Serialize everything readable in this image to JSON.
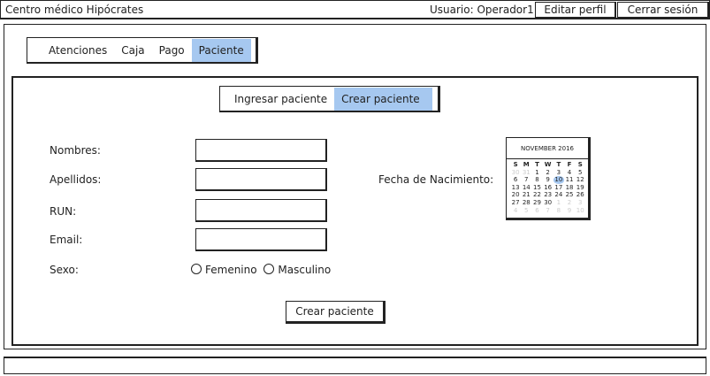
{
  "app": {
    "title": "Centro médico Hipócrates"
  },
  "header": {
    "user": "Usuario: Operador1",
    "edit_profile": "Editar perfil",
    "logout": "Cerrar sesión"
  },
  "nav": {
    "tabs": [
      "Atenciones",
      "Caja",
      "Pago",
      "Paciente"
    ],
    "active_index": 3
  },
  "subtabs": {
    "items": [
      "Ingresar paciente",
      "Crear paciente"
    ],
    "active_index": 1
  },
  "form": {
    "nombres_label": "Nombres:",
    "apellidos_label": "Apellidos:",
    "run_label": "RUN:",
    "email_label": "Email:",
    "sexo_label": "Sexo:",
    "sexo_options": [
      "Femenino",
      "Masculino"
    ],
    "fecha_label": "Fecha de Nacimiento:",
    "submit": "Crear paciente"
  },
  "calendar": {
    "title": "NOVEMBER 2016",
    "weekdays": [
      "S",
      "M",
      "T",
      "W",
      "T",
      "F",
      "S"
    ],
    "weeks": [
      [
        {
          "d": "30",
          "m": true
        },
        {
          "d": "31",
          "m": true
        },
        {
          "d": "1"
        },
        {
          "d": "2"
        },
        {
          "d": "3"
        },
        {
          "d": "4"
        },
        {
          "d": "5"
        }
      ],
      [
        {
          "d": "6"
        },
        {
          "d": "7"
        },
        {
          "d": "8"
        },
        {
          "d": "9"
        },
        {
          "d": "10",
          "h": true
        },
        {
          "d": "11"
        },
        {
          "d": "12"
        }
      ],
      [
        {
          "d": "13"
        },
        {
          "d": "14"
        },
        {
          "d": "15"
        },
        {
          "d": "16"
        },
        {
          "d": "17"
        },
        {
          "d": "18"
        },
        {
          "d": "19"
        }
      ],
      [
        {
          "d": "20"
        },
        {
          "d": "21"
        },
        {
          "d": "22"
        },
        {
          "d": "23"
        },
        {
          "d": "24"
        },
        {
          "d": "25"
        },
        {
          "d": "26"
        }
      ],
      [
        {
          "d": "27"
        },
        {
          "d": "28"
        },
        {
          "d": "29"
        },
        {
          "d": "30"
        },
        {
          "d": "1",
          "m": true
        },
        {
          "d": "2",
          "m": true
        },
        {
          "d": "3",
          "m": true
        }
      ],
      [
        {
          "d": "4",
          "m": true
        },
        {
          "d": "5",
          "m": true
        },
        {
          "d": "6",
          "m": true
        },
        {
          "d": "7",
          "m": true
        },
        {
          "d": "8",
          "m": true
        },
        {
          "d": "9",
          "m": true
        },
        {
          "d": "10",
          "m": true
        }
      ]
    ],
    "highlight_color": "#a6c8f0"
  },
  "colors": {
    "accent": "#a6c8f0",
    "border": "#222222"
  }
}
